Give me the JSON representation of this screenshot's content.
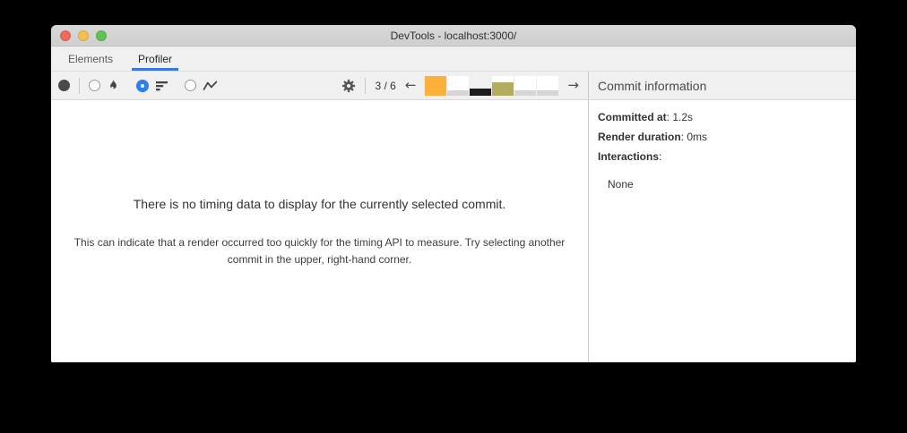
{
  "window": {
    "title": "DevTools - localhost:3000/"
  },
  "titlebar_buttons": {
    "close": "close",
    "minimize": "minimize",
    "zoom": "zoom"
  },
  "tabs": [
    {
      "label": "Elements",
      "selected": false
    },
    {
      "label": "Profiler",
      "selected": true
    }
  ],
  "toolbar": {
    "views": [
      {
        "name": "flamegraph",
        "selected": false
      },
      {
        "name": "ranked",
        "selected": true
      },
      {
        "name": "interactions",
        "selected": false
      }
    ],
    "commit_index": "3 / 6",
    "commit_bars": [
      {
        "height_pct": 100,
        "color": "#fcb13c",
        "selected": false
      },
      {
        "height_pct": 27,
        "color": "#d6d6d6",
        "selected": false
      },
      {
        "height_pct": 32,
        "color": "#1c1c1c",
        "selected": true
      },
      {
        "height_pct": 64,
        "color": "#b2ab60",
        "selected": false
      },
      {
        "height_pct": 27,
        "color": "#d6d6d6",
        "selected": false
      },
      {
        "height_pct": 27,
        "color": "#d6d6d6",
        "selected": false
      }
    ]
  },
  "icons": {
    "record": "filled-circle",
    "flamegraph": "flame",
    "ranked": "horizontal-bars",
    "interactions": "zigzag-line",
    "settings": "gear",
    "prev": "←",
    "next": "→"
  },
  "commit_info": {
    "header": "Commit information",
    "rows": [
      {
        "label": "Committed at",
        "rest": ": 1.2s"
      },
      {
        "label": "Render duration",
        "rest": ": 0ms"
      },
      {
        "label": "Interactions",
        "rest": ":"
      }
    ],
    "empty_value": "None"
  },
  "main": {
    "message_title": "There is no timing data to display for the currently selected commit.",
    "message_body": "This can indicate that a render occurred too quickly for the timing API to measure. Try selecting another commit in the upper, right-hand corner."
  },
  "colors": {
    "accent": "#2d7ff0",
    "accent_underline": "#3b78dd",
    "light_red": "#ee6a5e",
    "light_yellow": "#f5bf4f",
    "light_green": "#5fc454"
  }
}
